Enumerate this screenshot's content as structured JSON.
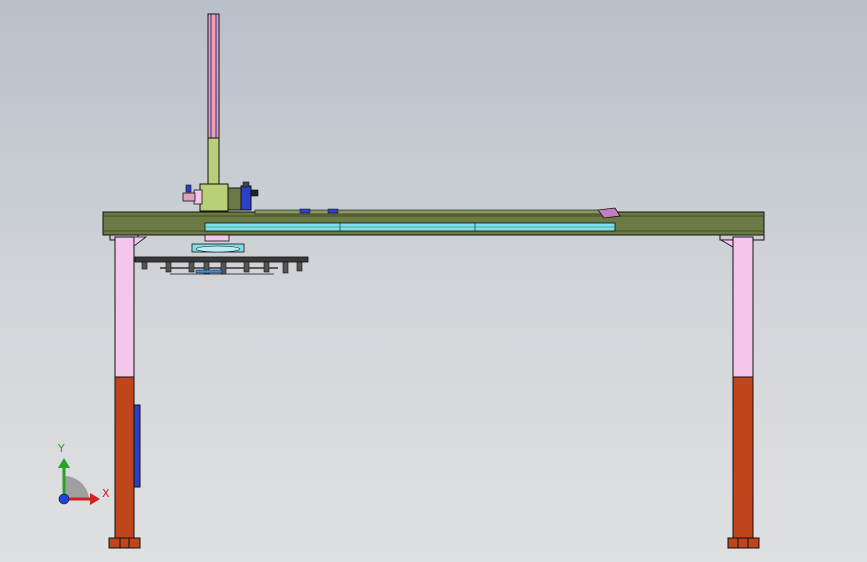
{
  "viewport": {
    "background_top": "#b9c0c9",
    "background_bottom": "#dfe0e1"
  },
  "colors": {
    "beam": "#6b7a45",
    "column_upper": "#f4c6ec",
    "column_lower": "#c0441c",
    "vertical_mast": "#f2a0a8",
    "mast_lower": "#b8d078",
    "rail": "#7fe0e8",
    "motor": "#2c3fc8",
    "outline": "#111111"
  },
  "triad": {
    "y_label": "Y",
    "x_label": "X",
    "y_color": "#2aa02a",
    "x_color": "#d42020",
    "z_color": "#2040e0"
  }
}
